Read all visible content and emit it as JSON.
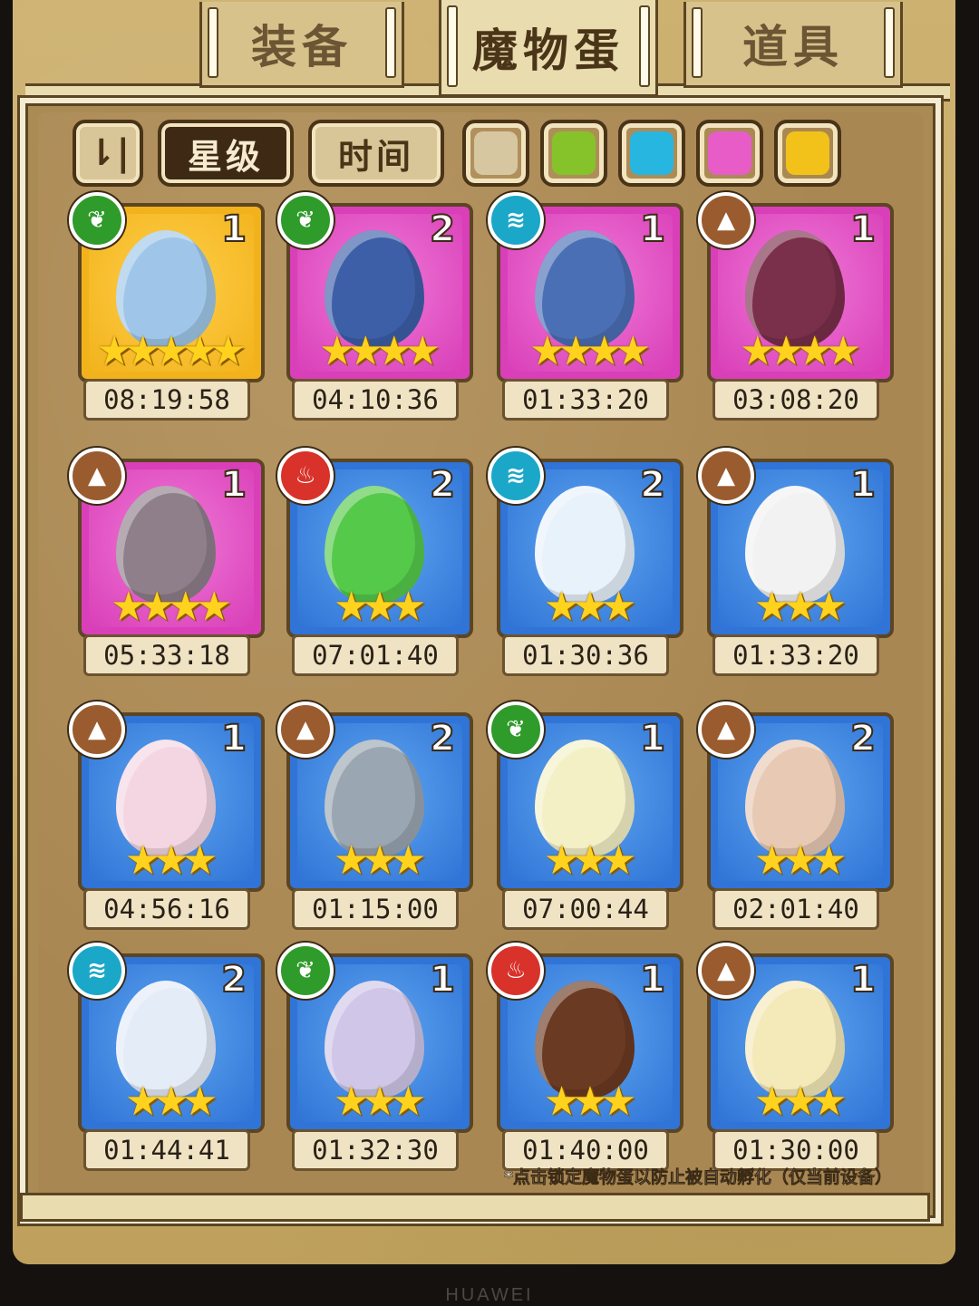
{
  "tabs": [
    {
      "label": "装备",
      "active": false
    },
    {
      "label": "魔物蛋",
      "active": true
    },
    {
      "label": "道具",
      "active": false
    }
  ],
  "filters": {
    "sort_icon": "sort-toggle-icon",
    "sort_glyph": "⇂|",
    "star_label": "星级",
    "time_label": "时间",
    "colors": [
      "#d7c7a0",
      "#86c22a",
      "#26b6e0",
      "#e85cc8",
      "#f2c21a"
    ]
  },
  "eggs": [
    {
      "element": "nature",
      "count": "1",
      "stars": 5,
      "rarity": "gold",
      "timer": "08:19:58",
      "art_color": "#9fc6e8"
    },
    {
      "element": "nature",
      "count": "2",
      "stars": 4,
      "rarity": "purple",
      "timer": "04:10:36",
      "art_color": "#3d5fa8"
    },
    {
      "element": "water",
      "count": "1",
      "stars": 4,
      "rarity": "purple",
      "timer": "01:33:20",
      "art_color": "#4b6fb5"
    },
    {
      "element": "earth",
      "count": "1",
      "stars": 4,
      "rarity": "purple",
      "timer": "03:08:20",
      "art_color": "#7a2f4a"
    },
    {
      "element": "earth",
      "count": "1",
      "stars": 4,
      "rarity": "purple",
      "timer": "05:33:18",
      "art_color": "#8f7f8a"
    },
    {
      "element": "fire",
      "count": "2",
      "stars": 3,
      "rarity": "blue",
      "timer": "07:01:40",
      "art_color": "#55c94a"
    },
    {
      "element": "water",
      "count": "2",
      "stars": 3,
      "rarity": "blue",
      "timer": "01:30:36",
      "art_color": "#e8f2fb"
    },
    {
      "element": "earth",
      "count": "1",
      "stars": 3,
      "rarity": "blue",
      "timer": "01:33:20",
      "art_color": "#f2f2f2"
    },
    {
      "element": "earth",
      "count": "1",
      "stars": 3,
      "rarity": "blue",
      "timer": "04:56:16",
      "art_color": "#f4d6e2"
    },
    {
      "element": "earth",
      "count": "2",
      "stars": 3,
      "rarity": "blue",
      "timer": "01:15:00",
      "art_color": "#9aa6b2"
    },
    {
      "element": "nature",
      "count": "1",
      "stars": 3,
      "rarity": "blue",
      "timer": "07:00:44",
      "art_color": "#f3f0c6"
    },
    {
      "element": "earth",
      "count": "2",
      "stars": 3,
      "rarity": "blue",
      "timer": "02:01:40",
      "art_color": "#e8c9b4"
    },
    {
      "element": "water",
      "count": "2",
      "stars": 3,
      "rarity": "blue",
      "timer": "01:44:41",
      "art_color": "#e4ecf8"
    },
    {
      "element": "nature",
      "count": "1",
      "stars": 3,
      "rarity": "blue",
      "timer": "01:32:30",
      "art_color": "#cfc6e8"
    },
    {
      "element": "fire",
      "count": "1",
      "stars": 3,
      "rarity": "blue",
      "timer": "01:40:00",
      "art_color": "#6b3a22"
    },
    {
      "element": "earth",
      "count": "1",
      "stars": 3,
      "rarity": "blue",
      "timer": "01:30:00",
      "art_color": "#f4e9b8"
    }
  ],
  "element_icons": {
    "nature": {
      "icon": "leaf-icon",
      "glyph": "❦",
      "color": "#2f9b2a"
    },
    "water": {
      "icon": "wave-icon",
      "glyph": "≋",
      "color": "#1aa7c8"
    },
    "earth": {
      "icon": "mountain-icon",
      "glyph": "▲",
      "color": "#9a5b2e"
    },
    "fire": {
      "icon": "flame-icon",
      "glyph": "♨",
      "color": "#d8322a"
    }
  },
  "rarity_colors": {
    "gold": {
      "border": "#f2b21c",
      "fill": "#ffd04a"
    },
    "purple": {
      "border": "#d93fb8",
      "fill": "#f07ad8"
    },
    "blue": {
      "border": "#2f74d6",
      "fill": "#5fa6f0"
    }
  },
  "footer_note": "*点击锁定魔物蛋以防止被自动孵化（仅当前设备）",
  "device_brand": "HUAWEI"
}
